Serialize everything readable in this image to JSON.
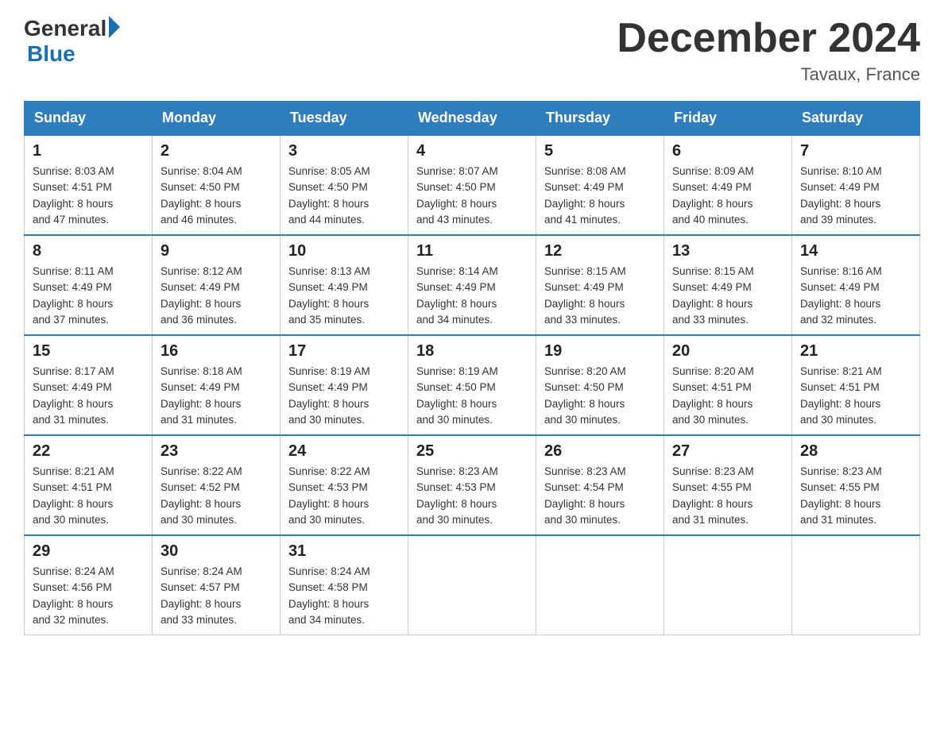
{
  "header": {
    "logo_general": "General",
    "logo_blue": "Blue",
    "calendar_title": "December 2024",
    "calendar_subtitle": "Tavaux, France"
  },
  "days_of_week": [
    "Sunday",
    "Monday",
    "Tuesday",
    "Wednesday",
    "Thursday",
    "Friday",
    "Saturday"
  ],
  "weeks": [
    [
      {
        "day": "1",
        "sunrise": "8:03 AM",
        "sunset": "4:51 PM",
        "daylight": "8 hours and 47 minutes."
      },
      {
        "day": "2",
        "sunrise": "8:04 AM",
        "sunset": "4:50 PM",
        "daylight": "8 hours and 46 minutes."
      },
      {
        "day": "3",
        "sunrise": "8:05 AM",
        "sunset": "4:50 PM",
        "daylight": "8 hours and 44 minutes."
      },
      {
        "day": "4",
        "sunrise": "8:07 AM",
        "sunset": "4:50 PM",
        "daylight": "8 hours and 43 minutes."
      },
      {
        "day": "5",
        "sunrise": "8:08 AM",
        "sunset": "4:49 PM",
        "daylight": "8 hours and 41 minutes."
      },
      {
        "day": "6",
        "sunrise": "8:09 AM",
        "sunset": "4:49 PM",
        "daylight": "8 hours and 40 minutes."
      },
      {
        "day": "7",
        "sunrise": "8:10 AM",
        "sunset": "4:49 PM",
        "daylight": "8 hours and 39 minutes."
      }
    ],
    [
      {
        "day": "8",
        "sunrise": "8:11 AM",
        "sunset": "4:49 PM",
        "daylight": "8 hours and 37 minutes."
      },
      {
        "day": "9",
        "sunrise": "8:12 AM",
        "sunset": "4:49 PM",
        "daylight": "8 hours and 36 minutes."
      },
      {
        "day": "10",
        "sunrise": "8:13 AM",
        "sunset": "4:49 PM",
        "daylight": "8 hours and 35 minutes."
      },
      {
        "day": "11",
        "sunrise": "8:14 AM",
        "sunset": "4:49 PM",
        "daylight": "8 hours and 34 minutes."
      },
      {
        "day": "12",
        "sunrise": "8:15 AM",
        "sunset": "4:49 PM",
        "daylight": "8 hours and 33 minutes."
      },
      {
        "day": "13",
        "sunrise": "8:15 AM",
        "sunset": "4:49 PM",
        "daylight": "8 hours and 33 minutes."
      },
      {
        "day": "14",
        "sunrise": "8:16 AM",
        "sunset": "4:49 PM",
        "daylight": "8 hours and 32 minutes."
      }
    ],
    [
      {
        "day": "15",
        "sunrise": "8:17 AM",
        "sunset": "4:49 PM",
        "daylight": "8 hours and 31 minutes."
      },
      {
        "day": "16",
        "sunrise": "8:18 AM",
        "sunset": "4:49 PM",
        "daylight": "8 hours and 31 minutes."
      },
      {
        "day": "17",
        "sunrise": "8:19 AM",
        "sunset": "4:49 PM",
        "daylight": "8 hours and 30 minutes."
      },
      {
        "day": "18",
        "sunrise": "8:19 AM",
        "sunset": "4:50 PM",
        "daylight": "8 hours and 30 minutes."
      },
      {
        "day": "19",
        "sunrise": "8:20 AM",
        "sunset": "4:50 PM",
        "daylight": "8 hours and 30 minutes."
      },
      {
        "day": "20",
        "sunrise": "8:20 AM",
        "sunset": "4:51 PM",
        "daylight": "8 hours and 30 minutes."
      },
      {
        "day": "21",
        "sunrise": "8:21 AM",
        "sunset": "4:51 PM",
        "daylight": "8 hours and 30 minutes."
      }
    ],
    [
      {
        "day": "22",
        "sunrise": "8:21 AM",
        "sunset": "4:51 PM",
        "daylight": "8 hours and 30 minutes."
      },
      {
        "day": "23",
        "sunrise": "8:22 AM",
        "sunset": "4:52 PM",
        "daylight": "8 hours and 30 minutes."
      },
      {
        "day": "24",
        "sunrise": "8:22 AM",
        "sunset": "4:53 PM",
        "daylight": "8 hours and 30 minutes."
      },
      {
        "day": "25",
        "sunrise": "8:23 AM",
        "sunset": "4:53 PM",
        "daylight": "8 hours and 30 minutes."
      },
      {
        "day": "26",
        "sunrise": "8:23 AM",
        "sunset": "4:54 PM",
        "daylight": "8 hours and 30 minutes."
      },
      {
        "day": "27",
        "sunrise": "8:23 AM",
        "sunset": "4:55 PM",
        "daylight": "8 hours and 31 minutes."
      },
      {
        "day": "28",
        "sunrise": "8:23 AM",
        "sunset": "4:55 PM",
        "daylight": "8 hours and 31 minutes."
      }
    ],
    [
      {
        "day": "29",
        "sunrise": "8:24 AM",
        "sunset": "4:56 PM",
        "daylight": "8 hours and 32 minutes."
      },
      {
        "day": "30",
        "sunrise": "8:24 AM",
        "sunset": "4:57 PM",
        "daylight": "8 hours and 33 minutes."
      },
      {
        "day": "31",
        "sunrise": "8:24 AM",
        "sunset": "4:58 PM",
        "daylight": "8 hours and 34 minutes."
      },
      null,
      null,
      null,
      null
    ]
  ],
  "labels": {
    "sunrise": "Sunrise:",
    "sunset": "Sunset:",
    "daylight": "Daylight:"
  }
}
